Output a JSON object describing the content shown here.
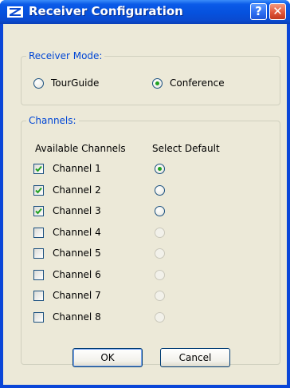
{
  "window": {
    "title": "Receiver Configuration",
    "help_symbol": "?",
    "close_symbol": "✕",
    "icons": [
      "sennheiser-logo-icon",
      "help-icon",
      "close-icon"
    ]
  },
  "receiver_mode": {
    "legend": "Receiver Mode:",
    "options": [
      {
        "label": "TourGuide",
        "selected": false
      },
      {
        "label": "Conference",
        "selected": true
      }
    ]
  },
  "channels": {
    "legend": "Channels:",
    "col_available": "Available Channels",
    "col_default": "Select Default",
    "rows": [
      {
        "label": "Channel 1",
        "checked": true,
        "default_state": "selected"
      },
      {
        "label": "Channel 2",
        "checked": true,
        "default_state": "enabled"
      },
      {
        "label": "Channel 3",
        "checked": true,
        "default_state": "enabled"
      },
      {
        "label": "Channel 4",
        "checked": false,
        "default_state": "disabled"
      },
      {
        "label": "Channel 5",
        "checked": false,
        "default_state": "disabled"
      },
      {
        "label": "Channel 6",
        "checked": false,
        "default_state": "disabled"
      },
      {
        "label": "Channel 7",
        "checked": false,
        "default_state": "disabled"
      },
      {
        "label": "Channel 8",
        "checked": false,
        "default_state": "disabled"
      }
    ]
  },
  "buttons": {
    "ok": "OK",
    "cancel": "Cancel"
  },
  "colors": {
    "titlebar": "#0651dd",
    "face": "#ece9d8",
    "legend_text": "#0046d5",
    "radio_dot": "#21a121",
    "check_mark": "#21a121",
    "close_button": "#e2573a"
  }
}
